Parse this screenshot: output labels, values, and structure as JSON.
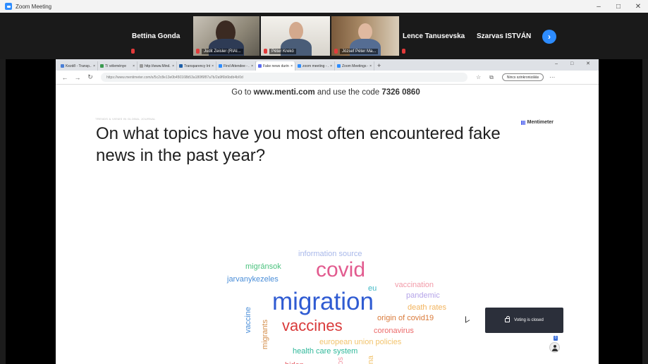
{
  "window": {
    "title": "Zoom Meeting",
    "controls": [
      "–",
      "□",
      "✕"
    ]
  },
  "participants": {
    "names_left": [
      "Bettina Gonda"
    ],
    "videos": [
      {
        "label": "Judit Zeisler (RIAI..."
      },
      {
        "label": "Péter Krekó"
      },
      {
        "label": "József Péter Ma..."
      }
    ],
    "names_right": [
      "Lence Tanusevska",
      "Szarvas ISTVÁN"
    ],
    "next_icon": "›"
  },
  "browser": {
    "tabs": [
      "Kezdő - Transp...",
      "Tí véleménye",
      "http://www.Mind...",
      "Transparency Inte...",
      "Find Attendee - ...",
      "Fake news during...",
      "zoom meeting - ...",
      "Zoom Meetings - ..."
    ],
    "active_tab_index": 5,
    "new_tab": "+",
    "url": "https://www.mentimeter.com/s/5c2c8e13e0b450168b53a180f6f87a7b/2a9f6b6bdb4b/0d",
    "sync_label": "Nincs szinkronizálás"
  },
  "slide": {
    "instruction_prefix": "Go to ",
    "instruction_site": "www.menti.com",
    "instruction_middle": " and use the code ",
    "instruction_code": "7326 0860",
    "small_header": "TRENDS & VIEWS IN GLOBAL JOURNAL",
    "brand": "Mentimeter",
    "question": "On what topics have you most often encountered fake news in the past year?",
    "voting_status": "Voting is closed",
    "audience_count": "0"
  },
  "wordcloud": {
    "information_source": "information source",
    "covid": "covid",
    "migransok": "migránsok",
    "jarvanykezeles": "jarvanykezeles",
    "eu": "eu",
    "vaccination": "vaccination",
    "pandemic": "pandemic",
    "migration": "migration",
    "death_rates": "death rates",
    "vaccine": "vaccine",
    "migrants": "migrants",
    "vaccines": "vaccines",
    "origin_of_covid19": "origin of covid19",
    "coronavirus": "coronavirus",
    "european_union_policies": "european union policies",
    "health_care_system": "health care system",
    "biden": "biden",
    "soros": "soros",
    "kina": "kina"
  },
  "colors": {
    "zoom_blue": "#2d8cff",
    "voting_panel": "#2b2f3a",
    "mic_red": "#e23a3a"
  }
}
